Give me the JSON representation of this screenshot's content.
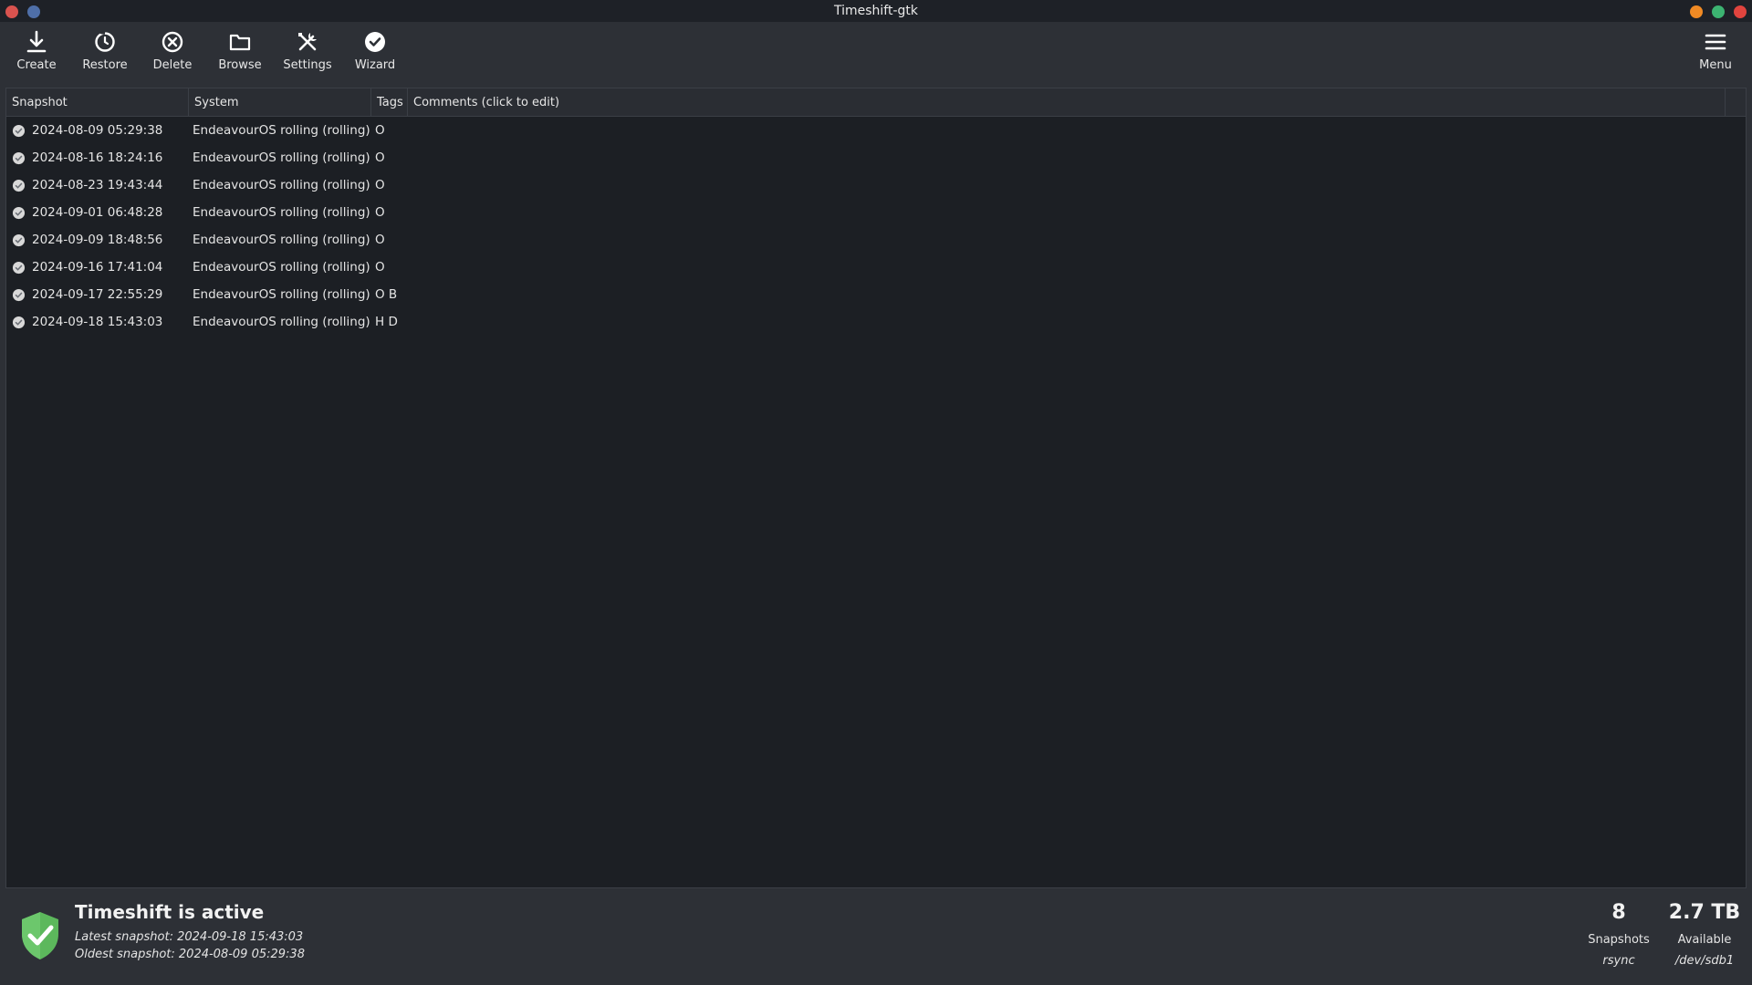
{
  "window": {
    "title": "Timeshift-gtk",
    "colors": {
      "close_left": "#d9534f",
      "pin_left": "#4f6fa8",
      "minimize": "#f08a24",
      "maximize": "#3cb371",
      "close": "#e0443e"
    }
  },
  "toolbar": {
    "create": "Create",
    "restore": "Restore",
    "delete": "Delete",
    "browse": "Browse",
    "settings": "Settings",
    "wizard": "Wizard",
    "menu": "Menu"
  },
  "table": {
    "headers": {
      "snapshot": "Snapshot",
      "system": "System",
      "tags": "Tags",
      "comments": "Comments (click to edit)"
    },
    "rows": [
      {
        "snapshot": "2024-08-09 05:29:38",
        "system": "EndeavourOS rolling (rolling)",
        "tags": "O"
      },
      {
        "snapshot": "2024-08-16 18:24:16",
        "system": "EndeavourOS rolling (rolling)",
        "tags": "O"
      },
      {
        "snapshot": "2024-08-23 19:43:44",
        "system": "EndeavourOS rolling (rolling)",
        "tags": "O"
      },
      {
        "snapshot": "2024-09-01 06:48:28",
        "system": "EndeavourOS rolling (rolling)",
        "tags": "O"
      },
      {
        "snapshot": "2024-09-09 18:48:56",
        "system": "EndeavourOS rolling (rolling)",
        "tags": "O"
      },
      {
        "snapshot": "2024-09-16 17:41:04",
        "system": "EndeavourOS rolling (rolling)",
        "tags": "O"
      },
      {
        "snapshot": "2024-09-17 22:55:29",
        "system": "EndeavourOS rolling (rolling)",
        "tags": "O B"
      },
      {
        "snapshot": "2024-09-18 15:43:03",
        "system": "EndeavourOS rolling (rolling)",
        "tags": "H D"
      }
    ]
  },
  "status": {
    "title": "Timeshift is active",
    "latest": "Latest snapshot: 2024-09-18 15:43:03",
    "oldest": "Oldest snapshot: 2024-08-09 05:29:38",
    "shield_color": "#5cb85c",
    "snapshots_count": "8",
    "snapshots_label": "Snapshots",
    "mode": "rsync",
    "available_size": "2.7 TB",
    "available_label": "Available",
    "device": "/dev/sdb1"
  }
}
